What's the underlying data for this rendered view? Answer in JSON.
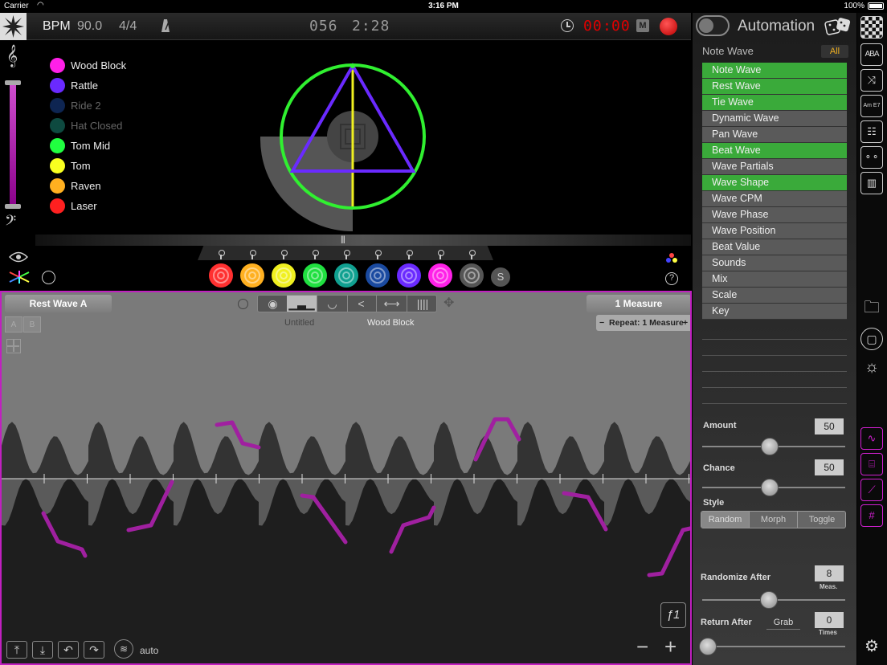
{
  "status": {
    "carrier": "Carrier",
    "time": "3:16 PM",
    "battery": "100%"
  },
  "topbar": {
    "bpm_label": "BPM",
    "bpm_value": "90.0",
    "time_sig": "4/4",
    "counter": "056",
    "clock": "2:28",
    "rec_min": "00",
    "rec_sep": ":",
    "rec_sec": "00",
    "m_button": "M"
  },
  "legend": [
    {
      "name": "Wood Block",
      "color": "#ff20e8",
      "dim": false
    },
    {
      "name": "Rattle",
      "color": "#6a2aff",
      "dim": false
    },
    {
      "name": "Ride 2",
      "color": "#0e2552",
      "dim": true
    },
    {
      "name": "Hat Closed",
      "color": "#0e4a40",
      "dim": true
    },
    {
      "name": "Tom Mid",
      "color": "#20ff40",
      "dim": false
    },
    {
      "name": "Tom",
      "color": "#f8ff20",
      "dim": false
    },
    {
      "name": "Raven",
      "color": "#ffb020",
      "dim": false
    },
    {
      "name": "Laser",
      "color": "#ff2020",
      "dim": false
    }
  ],
  "pads": [
    {
      "color": "#ff3030"
    },
    {
      "color": "#ffb020"
    },
    {
      "color": "#f0f020"
    },
    {
      "color": "#20e040"
    },
    {
      "color": "#10a090"
    },
    {
      "color": "#1a4aa0"
    },
    {
      "color": "#6a2aff"
    },
    {
      "color": "#ff20e8"
    },
    {
      "color": "#555555"
    }
  ],
  "s_button": "S",
  "help": "?",
  "editor": {
    "wave_name": "Rest Wave A",
    "measure": "1 Measure",
    "repeat_minus": "−",
    "repeat": "Repeat: 1 Measure",
    "repeat_plus": "+",
    "label_untitled": "Untitled",
    "label_instrument": "Wood Block",
    "tab_a": "A",
    "tab_b": "B",
    "fn_button": "ƒ1",
    "auto": "auto",
    "zoom_minus": "−",
    "zoom_plus": "+"
  },
  "panel": {
    "title": "Automation",
    "section": "Note Wave",
    "all": "All",
    "items": [
      {
        "label": "Note Wave",
        "on": true
      },
      {
        "label": "Rest Wave",
        "on": true
      },
      {
        "label": "Tie Wave",
        "on": true
      },
      {
        "label": "Dynamic Wave",
        "on": false
      },
      {
        "label": "Pan Wave",
        "on": false
      },
      {
        "label": "Beat Wave",
        "on": true
      },
      {
        "label": "Wave Partials",
        "on": false
      },
      {
        "label": "Wave Shape",
        "on": true
      },
      {
        "label": "Wave CPM",
        "on": false
      },
      {
        "label": "Wave Phase",
        "on": false
      },
      {
        "label": "Wave Position",
        "on": false
      },
      {
        "label": "Beat Value",
        "on": false
      },
      {
        "label": "Sounds",
        "on": false
      },
      {
        "label": "Mix",
        "on": false
      },
      {
        "label": "Scale",
        "on": false
      },
      {
        "label": "Key",
        "on": false
      }
    ],
    "amount_label": "Amount",
    "amount_value": "50",
    "chance_label": "Chance",
    "chance_value": "50",
    "style_label": "Style",
    "style_options": [
      "Random",
      "Morph",
      "Toggle"
    ],
    "randomize_label": "Randomize After",
    "randomize_value": "8",
    "randomize_unit": "Meas.",
    "return_label": "Return After",
    "return_grab": "Grab",
    "return_value": "0",
    "return_unit": "Times"
  },
  "sidebar_icons": {
    "aba": "ABA",
    "chord": "Am E7"
  }
}
